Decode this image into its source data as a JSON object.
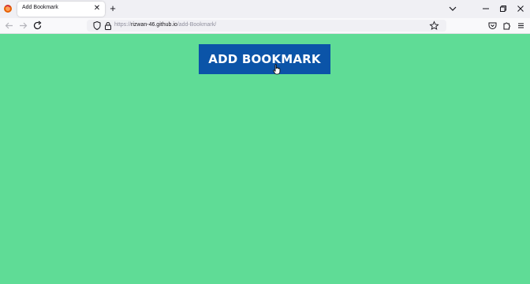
{
  "browser": {
    "tab": {
      "title": "Add Bookmark"
    },
    "url": {
      "scheme": "https://",
      "host": "rizwan-46.github.io",
      "path": "/add-Bookmark/"
    }
  },
  "page": {
    "background_color": "#5fdc96",
    "add_button": {
      "label": "ADD BOOKMARK",
      "color": "#0b54a8"
    }
  }
}
